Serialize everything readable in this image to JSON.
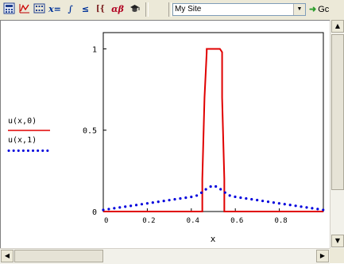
{
  "toolbar": {
    "icons": [
      "calculator-icon",
      "graph-icon",
      "matrix-icon",
      "evaluate-icon",
      "calculus-icon",
      "boolean-icon",
      "programming-icon",
      "greek-icon",
      "symbolic-icon"
    ],
    "glyphs": {
      "evaluate": "x=",
      "greek": "αβ",
      "calculus": "∫",
      "boolean": "≤",
      "programming": "[{"
    },
    "site_select": {
      "value": "My Site"
    },
    "go_label": "Gc"
  },
  "legend": {
    "entries": [
      {
        "label": "u(x,0)",
        "color": "#e00000",
        "style": "solid"
      },
      {
        "label": "u(x,1)",
        "color": "#0000dd",
        "style": "dotted"
      }
    ]
  },
  "chart_data": {
    "type": "line",
    "xlabel": "x",
    "xlim": [
      0,
      1
    ],
    "ylim": [
      0,
      1.1
    ],
    "xticks": [
      "0",
      "0.2",
      "0.4",
      "0.6",
      "0.8"
    ],
    "yticks": [
      "0",
      "0.5",
      "1"
    ],
    "series": [
      {
        "name": "u(x,0)",
        "color": "#e00000",
        "style": "solid",
        "x": [
          0.0,
          0.45,
          0.45,
          0.46,
          0.47,
          0.47,
          0.53,
          0.54,
          0.54,
          0.55,
          0.55,
          1.0
        ],
        "y": [
          0.0,
          0.0,
          0.2,
          0.7,
          0.98,
          1.0,
          1.0,
          0.98,
          0.7,
          0.2,
          0.0,
          0.0
        ]
      },
      {
        "name": "u(x,1)",
        "color": "#0000dd",
        "style": "dotted",
        "x": [
          0.0,
          0.05,
          0.1,
          0.15,
          0.2,
          0.25,
          0.3,
          0.35,
          0.4,
          0.43,
          0.45,
          0.47,
          0.49,
          0.5,
          0.51,
          0.53,
          0.55,
          0.57,
          0.6,
          0.65,
          0.7,
          0.75,
          0.8,
          0.85,
          0.9,
          0.95,
          1.0
        ],
        "y": [
          0.01,
          0.02,
          0.03,
          0.04,
          0.05,
          0.06,
          0.07,
          0.08,
          0.09,
          0.1,
          0.12,
          0.14,
          0.155,
          0.16,
          0.155,
          0.14,
          0.12,
          0.1,
          0.09,
          0.08,
          0.07,
          0.06,
          0.05,
          0.04,
          0.03,
          0.02,
          0.01
        ]
      }
    ]
  }
}
